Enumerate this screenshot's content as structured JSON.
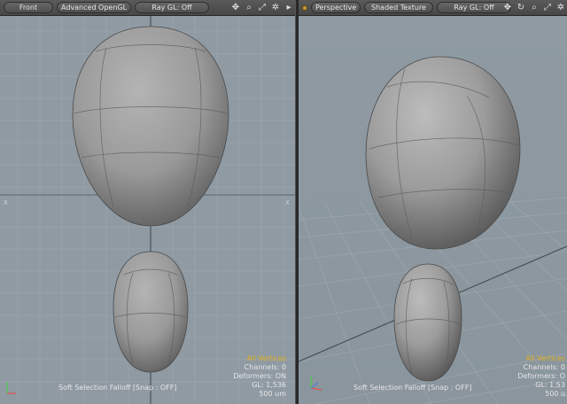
{
  "left_viewport": {
    "view_label": "Front",
    "render_label": "Advanced OpenGL",
    "raygl_label": "Ray GL: Off",
    "info": {
      "selection": "All Vertices",
      "channels": "Channels: 0",
      "deformers": "Deformers: ON",
      "gl": "GL: 1,536",
      "scale": "500 um"
    },
    "falloff": "Soft Selection Falloff   [Snap : OFF]",
    "axis_marks": [
      "X",
      "X"
    ]
  },
  "right_viewport": {
    "view_label": "Perspective",
    "render_label": "Shaded Texture",
    "raygl_label": "Ray GL: Off",
    "info": {
      "selection": "All Vertices",
      "channels": "Channels: 0",
      "deformers": "Deformers: O",
      "gl": "GL: 1,53",
      "scale": "500 u"
    },
    "falloff": "Soft Selection Falloff   [Snap : OFF]"
  },
  "icons": {
    "move": "move-icon",
    "zoom": "zoom-icon",
    "fit": "fit-icon",
    "settings": "gear-icon",
    "more": "arrow-right-icon",
    "rotate": "rotate-icon"
  },
  "colors": {
    "viewport_bg": "#8f9aa3",
    "accent": "#e0b020"
  }
}
